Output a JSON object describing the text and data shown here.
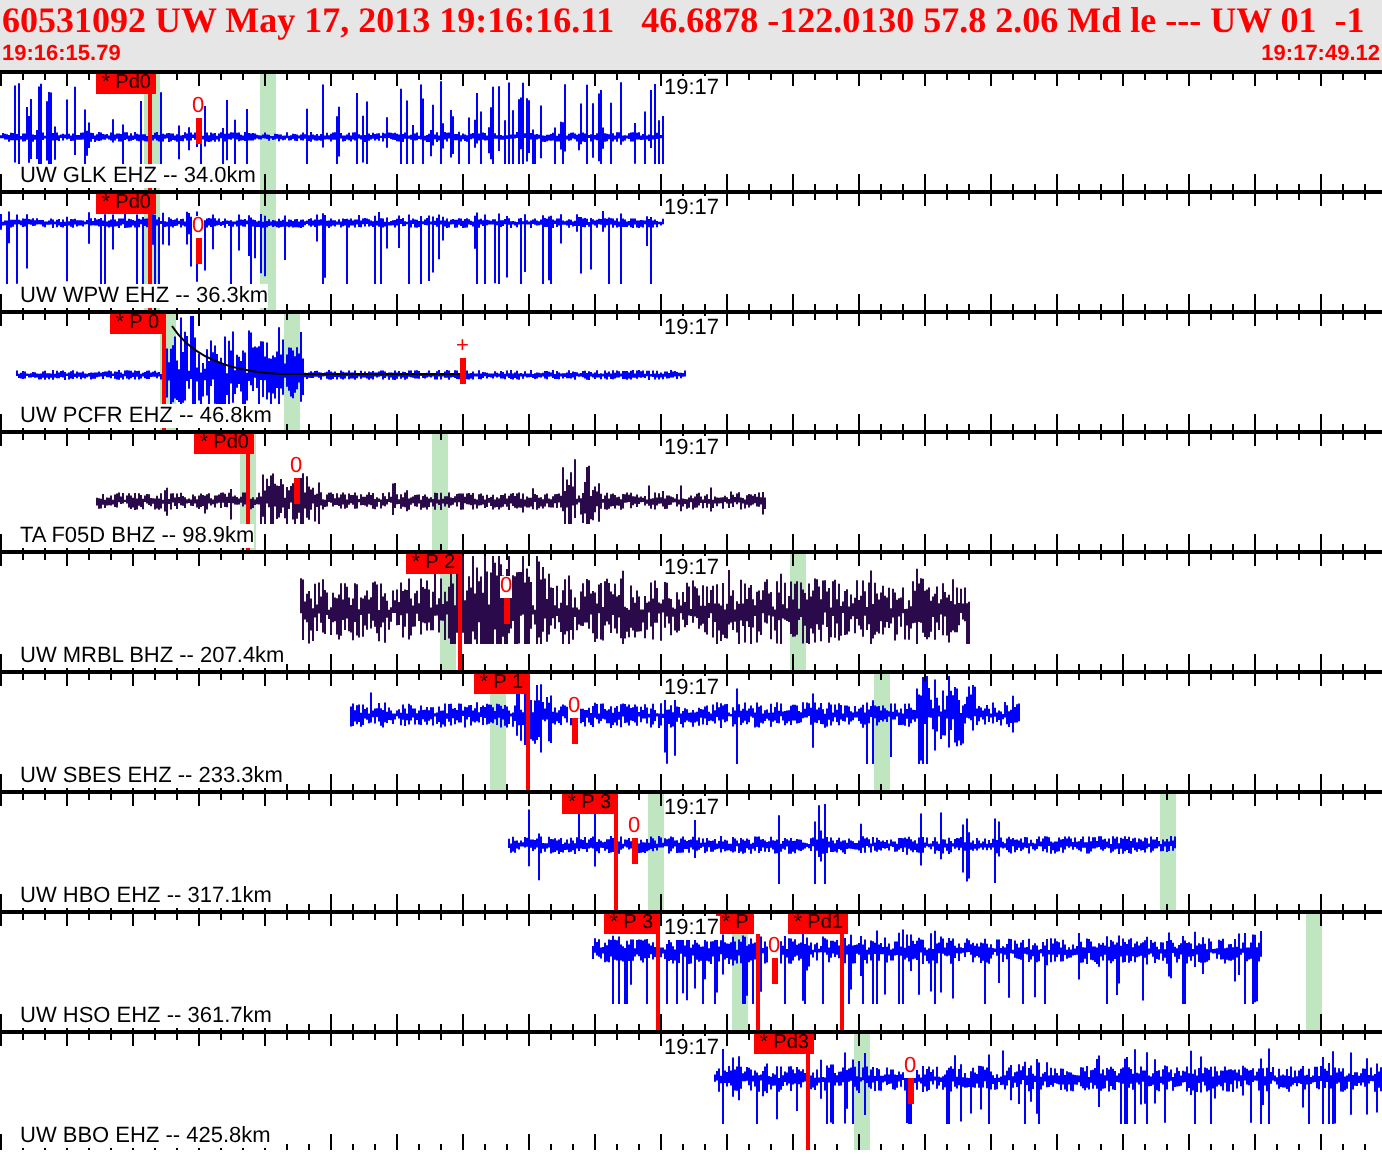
{
  "header": {
    "title": "60531092 UW May 17, 2013 19:16:16.11   46.6878 -122.0130 57.8 2.06 Md le --- UW 01  -1",
    "start_time": "19:16:15.79",
    "end_time": "19:17:49.12"
  },
  "channels": [
    {
      "label": "UW GLK EHZ -- 34.0km",
      "time_mark": "19:17",
      "picks": [
        {
          "kind": "flag",
          "text": "* Pd0"
        },
        {
          "kind": "marker",
          "text": "0"
        }
      ]
    },
    {
      "label": "UW WPW EHZ -- 36.3km",
      "time_mark": "19:17",
      "picks": [
        {
          "kind": "flag",
          "text": "* Pd0"
        },
        {
          "kind": "marker",
          "text": "0"
        }
      ]
    },
    {
      "label": "UW PCFR EHZ -- 46.8km",
      "time_mark": "19:17",
      "picks": [
        {
          "kind": "flag",
          "text": "* P 0"
        },
        {
          "kind": "marker",
          "text": "+"
        }
      ]
    },
    {
      "label": "TA F05D BHZ -- 98.9km",
      "time_mark": "19:17",
      "picks": [
        {
          "kind": "flag",
          "text": "* Pd0"
        },
        {
          "kind": "marker",
          "text": "0"
        }
      ]
    },
    {
      "label": "UW MRBL BHZ -- 207.4km",
      "time_mark": "19:17",
      "picks": [
        {
          "kind": "flag",
          "text": "* P 2"
        },
        {
          "kind": "marker",
          "text": "0"
        }
      ]
    },
    {
      "label": "UW SBES EHZ -- 233.3km",
      "time_mark": "19:17",
      "picks": [
        {
          "kind": "flag",
          "text": "* P 1"
        },
        {
          "kind": "marker",
          "text": "0"
        }
      ]
    },
    {
      "label": "UW HBO EHZ -- 317.1km",
      "time_mark": "19:17",
      "picks": [
        {
          "kind": "flag",
          "text": "* P 3"
        },
        {
          "kind": "marker",
          "text": "0"
        }
      ]
    },
    {
      "label": "UW HSO EHZ -- 361.7km",
      "time_mark": "19:17",
      "picks": [
        {
          "kind": "flag",
          "text": "* P 3"
        },
        {
          "kind": "flag",
          "text": "* P"
        },
        {
          "kind": "marker",
          "text": "0"
        },
        {
          "kind": "flag",
          "text": "* Pd1"
        }
      ]
    },
    {
      "label": "UW BBO EHZ -- 425.8km",
      "time_mark": "19:17",
      "picks": [
        {
          "kind": "flag",
          "text": "* Pd3"
        },
        {
          "kind": "marker",
          "text": "0"
        }
      ]
    }
  ]
}
